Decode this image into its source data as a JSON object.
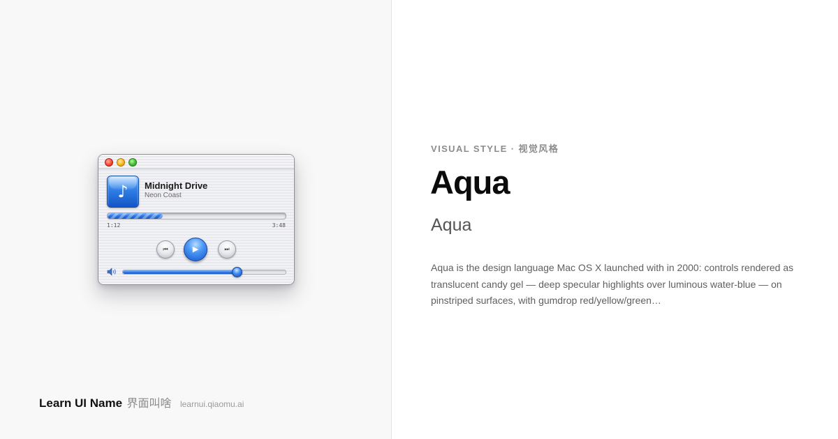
{
  "player": {
    "track_title": "Midnight Drive",
    "artist": "Neon Coast",
    "album_icon": "music-note-icon",
    "album_glyph": "♪",
    "elapsed": "1:12",
    "total": "3:48",
    "progress_fraction": 0.31,
    "volume_fraction": 0.7,
    "controls": {
      "prev_glyph": "⏮",
      "play_glyph": "▶",
      "next_glyph": "⏭"
    },
    "traffic_lights": [
      "close",
      "minimize",
      "zoom"
    ]
  },
  "brand": {
    "name": "Learn UI Name",
    "name_cn": "界面叫啥",
    "url": "learnui.qiaomu.ai"
  },
  "content": {
    "eyebrow": "VISUAL STYLE · 视觉风格",
    "title": "Aqua",
    "subtitle": "Aqua",
    "description": "Aqua is the design language Mac OS X launched with in 2000: controls rendered as translucent candy gel — deep specular highlights over luminous water-blue — on pinstriped surfaces, with gumdrop red/yellow/green…"
  },
  "colors": {
    "aqua_blue": "#2b73e0",
    "close_red": "#ff5a46",
    "minimize_yellow": "#ffbf2e",
    "zoom_green": "#4ccb3b"
  }
}
